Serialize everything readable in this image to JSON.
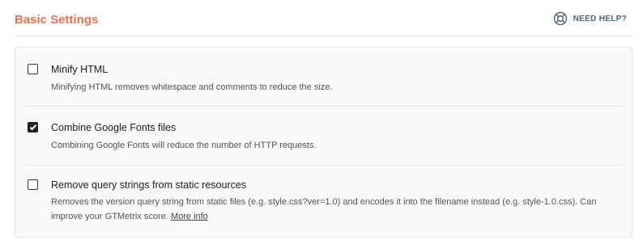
{
  "header": {
    "title": "Basic Settings",
    "help_label": "NEED HELP?",
    "help_icon": "lifebuoy-icon",
    "accent_color": "#ea7253"
  },
  "options": [
    {
      "label": "Minify HTML",
      "description": "Minifying HTML removes whitespace and comments to reduce the size.",
      "checked": false
    },
    {
      "label": "Combine Google Fonts files",
      "description": "Combining Google Fonts will reduce the number of HTTP requests.",
      "checked": true
    },
    {
      "label": "Remove query strings from static resources",
      "description": "Removes the version query string from static files (e.g. style.css?ver=1.0) and encodes it into the filename instead (e.g. style-1.0.css). Can improve your GTMetrix score.",
      "link_text": "More info",
      "checked": false
    }
  ]
}
